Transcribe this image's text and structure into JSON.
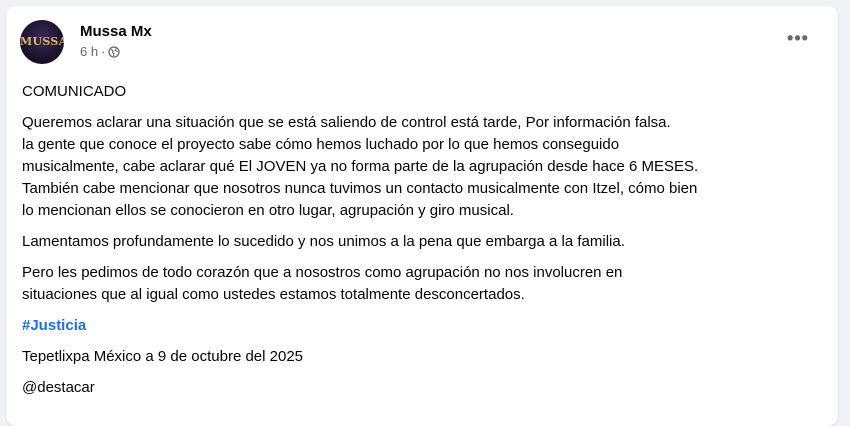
{
  "post": {
    "author": "Mussa Mx",
    "avatar_text": "MUSSA",
    "time": "6 h",
    "separator": "·",
    "privacy_icon": "globe-icon",
    "more_label": "•••",
    "heading": "COMUNICADO",
    "paragraph1": [
      "Queremos aclarar una situación que se está saliendo de control está tarde, Por información falsa.",
      "la gente que conoce el proyecto sabe cómo hemos luchado por lo que hemos conseguido",
      "musicalmente, cabe aclarar qué El JOVEN ya no forma parte de la agrupación desde hace 6 MESES.",
      "También cabe mencionar que nosotros nunca tuvimos un contacto musicalmente con Itzel, cómo bien",
      "lo mencionan ellos se conocieron en otro lugar, agrupación y giro musical."
    ],
    "paragraph2": "Lamentamos profundamente lo sucedido y nos unimos a la pena que embarga a la familia.",
    "paragraph3": [
      "Pero les pedimos de todo corazón que a nosostros como agrupación no nos involucren en",
      "situaciones que al igual como ustedes estamos totalmente desconcertados."
    ],
    "hashtag": "#Justicia",
    "location_date": "Tepetlixpa México a 9 de octubre del 2025",
    "mention": "@destacar"
  },
  "colors": {
    "background": "#f0f2f5",
    "card": "#ffffff",
    "hashtag": "#216fdb",
    "meta": "#65676b"
  }
}
